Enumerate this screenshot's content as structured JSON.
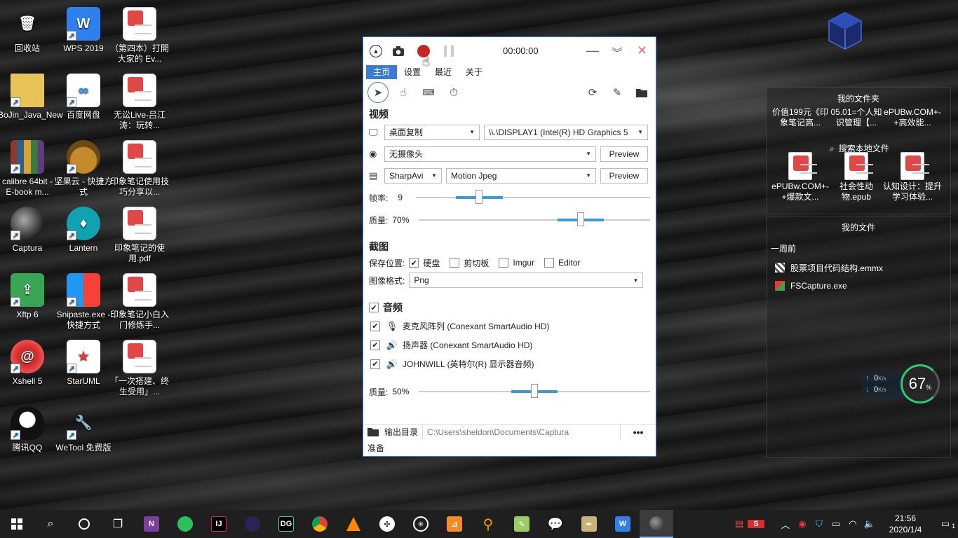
{
  "desktop": {
    "col1": [
      {
        "label": "回收站",
        "icon": "recycle-bin-icon"
      },
      {
        "label": "BoJin_Java_New",
        "icon": "folder-icon"
      },
      {
        "label": "calibre 64bit - E-book m...",
        "icon": "calibre-icon"
      },
      {
        "label": "Captura",
        "icon": "captura-icon"
      },
      {
        "label": "Xftp 6",
        "icon": "xftp-icon"
      },
      {
        "label": "Xshell 5",
        "icon": "xshell-icon"
      },
      {
        "label": "腾讯QQ",
        "icon": "qq-icon"
      }
    ],
    "col2": [
      {
        "label": "WPS 2019",
        "icon": "wps-icon"
      },
      {
        "label": "百度网盘",
        "icon": "baidu-netdisk-icon"
      },
      {
        "label": "坚果云 - 快捷方式",
        "icon": "nutstore-icon"
      },
      {
        "label": "Lantern",
        "icon": "lantern-icon"
      },
      {
        "label": "Snipaste.exe - 快捷方式",
        "icon": "snipaste-icon"
      },
      {
        "label": "StarUML",
        "icon": "staruml-icon"
      },
      {
        "label": "WeTool 免费版",
        "icon": "wetool-icon"
      }
    ],
    "col3": [
      {
        "label": "（第四本）打開大家的 Ev...",
        "icon": "pdf-file-icon"
      },
      {
        "label": "无讼Live-吕江涛：玩转...",
        "icon": "pdf-file-icon"
      },
      {
        "label": "印象笔记使用技巧分享以...",
        "icon": "pdf-file-icon"
      },
      {
        "label": "印象笔记的使用.pdf",
        "icon": "pdf-file-icon"
      },
      {
        "label": "印象笔记小白入门修炼手...",
        "icon": "pdf-file-icon"
      },
      {
        "label": "「一次搭建、终生受用」...",
        "icon": "pdf-file-icon"
      }
    ]
  },
  "captura": {
    "timer": "00:00:00",
    "tabs": [
      {
        "label": "主页",
        "active": true
      },
      {
        "label": "设置",
        "active": false
      },
      {
        "label": "最近",
        "active": false
      },
      {
        "label": "关于",
        "active": false
      }
    ],
    "video": {
      "heading": "视频",
      "source_mode": "桌面复制",
      "source_display": "\\\\.\\DISPLAY1 (Intel(R) HD Graphics 5",
      "webcam": "无摄像头",
      "preview_label": "Preview",
      "writer": "SharpAvi",
      "codec": "Motion Jpeg",
      "fps_label": "帧率:",
      "fps_value": "9",
      "fps_fraction": 0.27,
      "quality_label": "质量:",
      "quality_value": "70%",
      "quality_fraction": 0.7
    },
    "screenshot": {
      "heading": "截图",
      "save_label": "保存位置:",
      "targets": [
        {
          "label": "硬盘",
          "checked": true
        },
        {
          "label": "剪切板",
          "checked": false
        },
        {
          "label": "Imgur",
          "checked": false
        },
        {
          "label": "Editor",
          "checked": false
        }
      ],
      "format_label": "图像格式:",
      "format_value": "Png"
    },
    "audio": {
      "heading": "音频",
      "enabled": true,
      "devices": [
        {
          "label": "麦克风阵列 (Conexant SmartAudio HD)",
          "icon": "microphone-icon",
          "checked": true
        },
        {
          "label": "扬声器 (Conexant SmartAudio HD)",
          "icon": "speaker-icon",
          "checked": true
        },
        {
          "label": "JOHNWILL (英特尔(R) 显示器音频)",
          "icon": "speaker-icon",
          "checked": true
        }
      ],
      "quality_label": "质量:",
      "quality_value": "50%",
      "quality_fraction": 0.5
    },
    "output_label": "输出目录",
    "output_path": "C:\\Users\\sheldon\\Documents\\Captura",
    "more_label": "•••",
    "status": "准备"
  },
  "folder_panel": {
    "title": "我的文件夹",
    "search_label": "搜索本地文件",
    "tiles": [
      {
        "label": "价值199元《印象笔记高..."
      },
      {
        "label": "05.01=个人知识管理【..."
      },
      {
        "label": "ePUBw.COM+-+高效能..."
      },
      {
        "label": "ePUBw.COM+-+爆款文..."
      },
      {
        "label": "社会性动物.epub"
      },
      {
        "label": "认知设计：提升学习体验..."
      }
    ]
  },
  "files_panel": {
    "title": "我的文件",
    "group": "一周前",
    "files": [
      {
        "label": "股票项目代码结构.emmx"
      },
      {
        "label": "FSCapture.exe"
      }
    ]
  },
  "netmeter": {
    "up": "0",
    "down": "0",
    "unit": "K/s",
    "percent": "67",
    "percent_sign": "%"
  },
  "taskbar": {
    "time": "21:56",
    "date": "2020/1/4",
    "notification_count": "1"
  },
  "colors": {
    "accent": "#3a7bd5",
    "record": "#c62828",
    "slider_fill": "#3a9ad9"
  }
}
